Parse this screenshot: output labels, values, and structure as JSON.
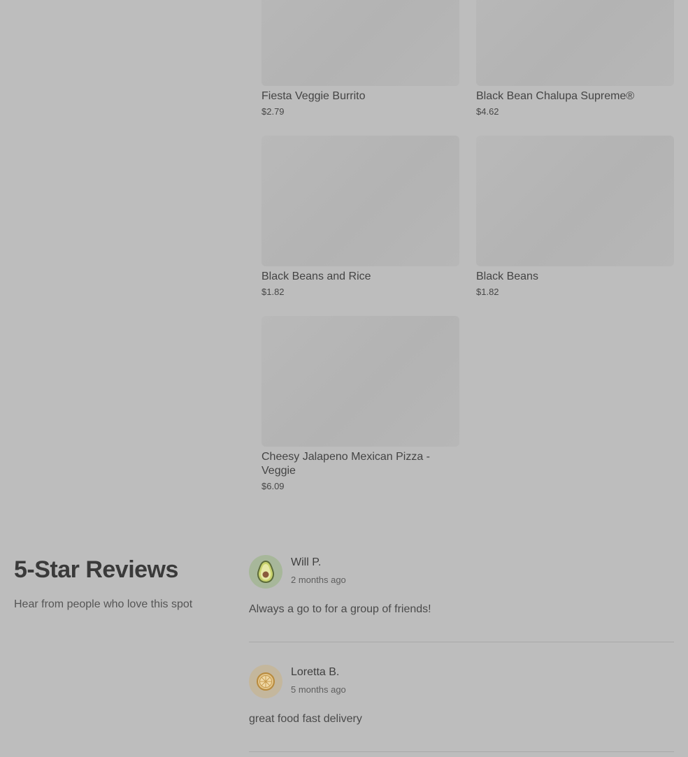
{
  "menu": {
    "items": [
      {
        "name": "Fiesta Veggie Burrito",
        "price": "$2.79"
      },
      {
        "name": "Black Bean Chalupa Supreme®",
        "price": "$4.62"
      },
      {
        "name": "Black Beans and Rice",
        "price": "$1.82"
      },
      {
        "name": "Black Beans",
        "price": "$1.82"
      },
      {
        "name": "Cheesy Jalapeno Mexican Pizza - Veggie",
        "price": "$6.09"
      }
    ]
  },
  "reviews": {
    "title": "5-Star Reviews",
    "subtitle": "Hear from people who love this spot",
    "items": [
      {
        "author": "Will P.",
        "when": "2 months ago",
        "text": "Always a go to for a group of friends!",
        "avatar_icon": "avocado-icon",
        "avatar_color": "#a7b79a"
      },
      {
        "author": "Loretta B.",
        "when": "5 months ago",
        "text": "great food fast delivery",
        "avatar_icon": "citrus-slice-icon",
        "avatar_color": "#c4b79d"
      }
    ]
  }
}
